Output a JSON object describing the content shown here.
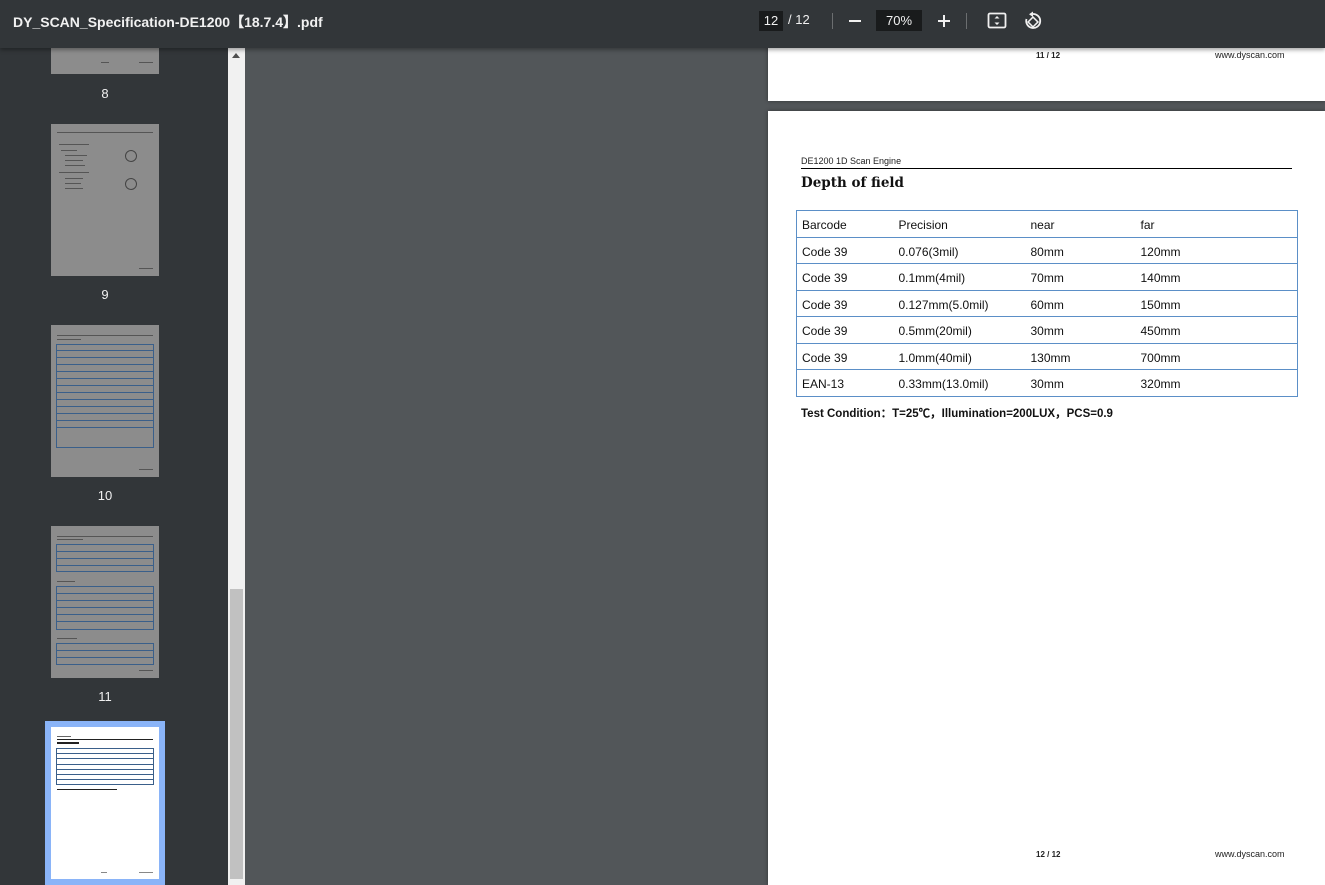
{
  "toolbar": {
    "title": "DY_SCAN_Specification-DE1200【18.7.4】.pdf",
    "current_page": "12",
    "total_pages": "/ 12",
    "zoom": "70%",
    "icons": [
      "minus-icon",
      "plus-icon",
      "fit-page-icon",
      "rotate-icon"
    ]
  },
  "sidebar": {
    "thumbnails": [
      {
        "label": "8"
      },
      {
        "label": "9"
      },
      {
        "label": "10"
      },
      {
        "label": "11"
      },
      {
        "label": "12",
        "selected": true
      }
    ]
  },
  "page11": {
    "footer_num": "11 / 12",
    "footer_site": "www.dyscan.com"
  },
  "page12": {
    "header": "DE1200 1D Scan Engine",
    "heading": "Depth of field",
    "table": {
      "headers": [
        "Barcode",
        "Precision",
        "near",
        "far"
      ],
      "rows": [
        [
          "Code 39",
          "0.076(3mil)",
          "80mm",
          "120mm"
        ],
        [
          "Code 39",
          "0.1mm(4mil)",
          "70mm",
          "140mm"
        ],
        [
          "Code 39",
          "0.127mm(5.0mil)",
          "60mm",
          "150mm"
        ],
        [
          "Code 39",
          "0.5mm(20mil)",
          "30mm",
          "450mm"
        ],
        [
          "Code 39",
          "1.0mm(40mil)",
          "130mm",
          "700mm"
        ],
        [
          "EAN-13",
          "0.33mm(13.0mil)",
          "30mm",
          "320mm"
        ]
      ]
    },
    "test_condition": "Test Condition：T=25℃，Illumination=200LUX，PCS=0.9",
    "footer_num": "12 / 12",
    "footer_site": "www.dyscan.com"
  },
  "colors": {
    "toolbar_bg": "#323639",
    "viewer_bg": "#525659",
    "selection": "#8ab4f8",
    "table_border": "#5b8fc7"
  }
}
